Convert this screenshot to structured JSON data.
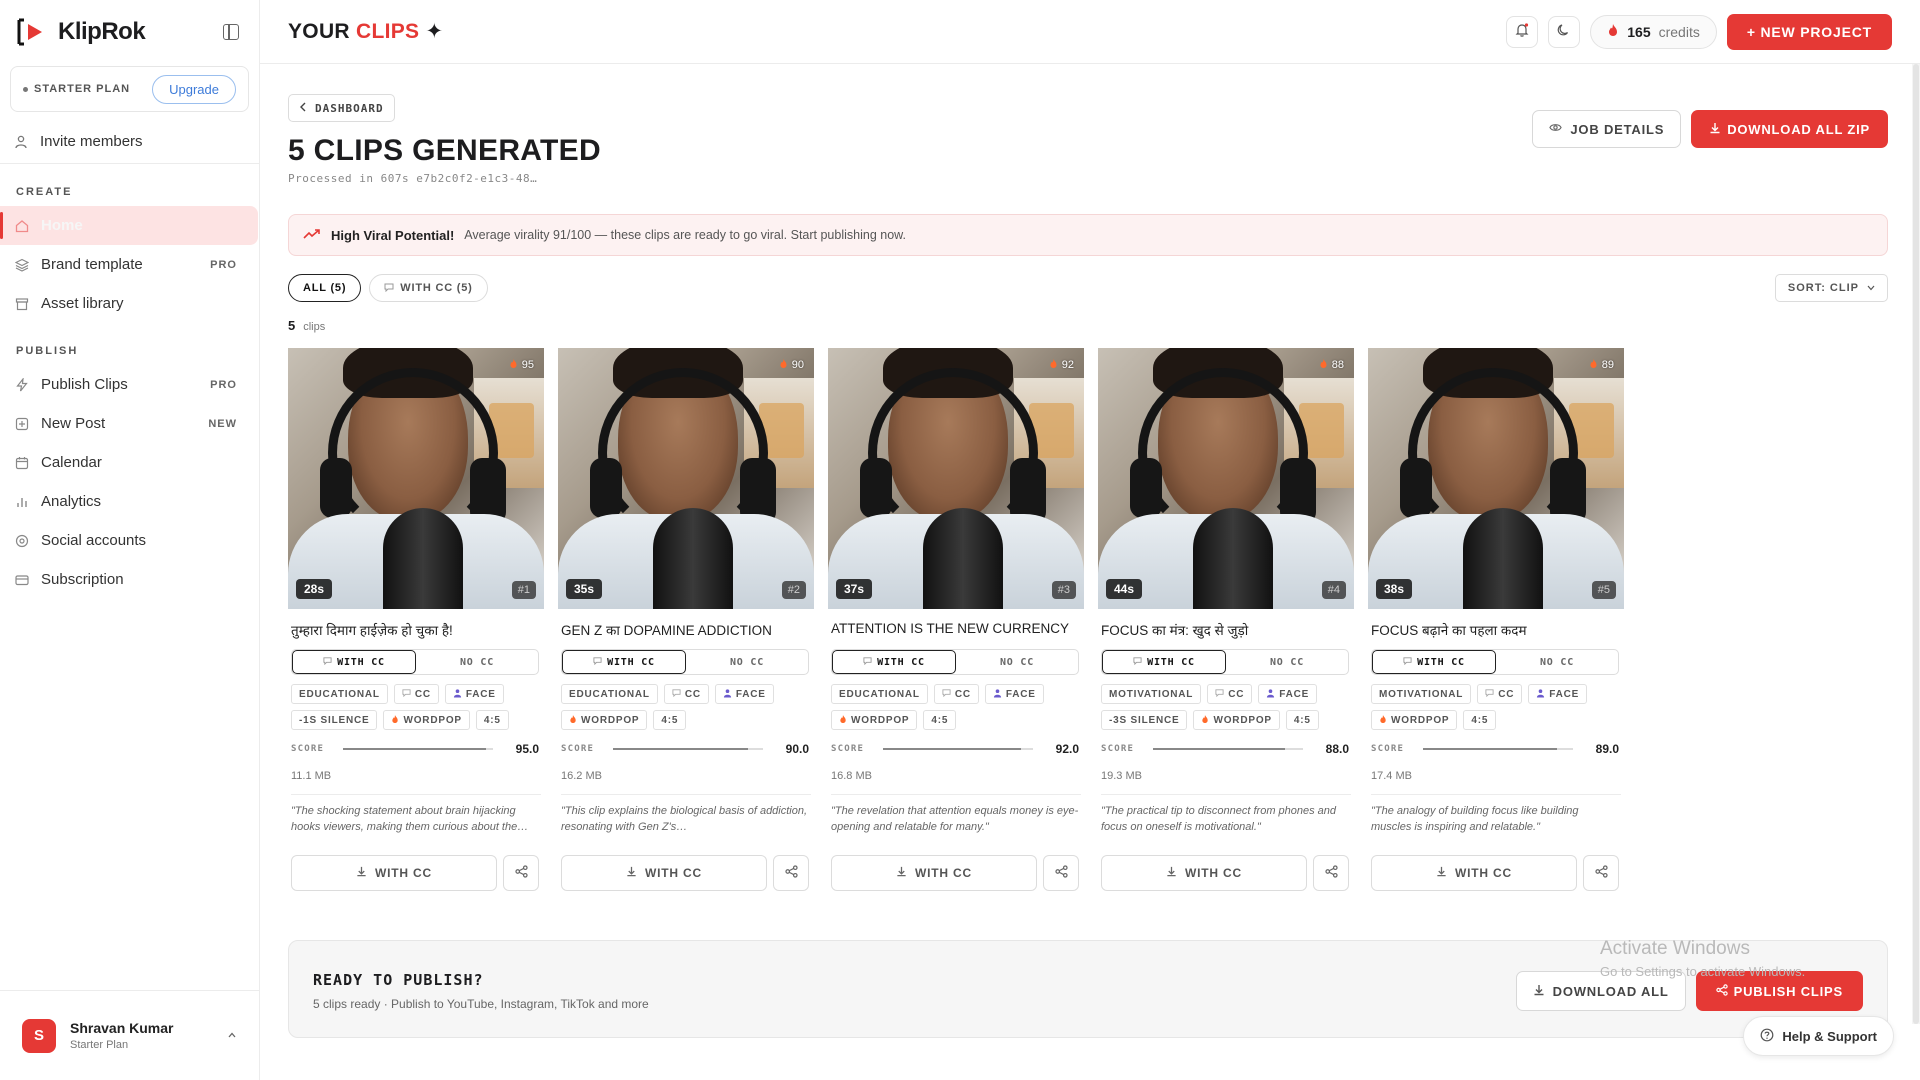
{
  "brand": {
    "name": "KlipRok"
  },
  "sidebar": {
    "plan_label": "STARTER PLAN",
    "upgrade_label": "Upgrade",
    "invite_label": "Invite members",
    "sections": [
      {
        "title": "CREATE",
        "items": [
          {
            "label": "Home",
            "icon": "home-icon",
            "badge": "",
            "active": true
          },
          {
            "label": "Brand template",
            "icon": "layers-icon",
            "badge": "PRO",
            "active": false
          },
          {
            "label": "Asset library",
            "icon": "archive-icon",
            "badge": "",
            "active": false
          }
        ]
      },
      {
        "title": "PUBLISH",
        "items": [
          {
            "label": "Publish Clips",
            "icon": "bolt-icon",
            "badge": "PRO",
            "active": false
          },
          {
            "label": "New Post",
            "icon": "plus-square-icon",
            "badge": "NEW",
            "active": false
          },
          {
            "label": "Calendar",
            "icon": "calendar-icon",
            "badge": "",
            "active": false
          },
          {
            "label": "Analytics",
            "icon": "bar-chart-icon",
            "badge": "",
            "active": false
          },
          {
            "label": "Social accounts",
            "icon": "at-icon",
            "badge": "",
            "active": false
          },
          {
            "label": "Subscription",
            "icon": "card-icon",
            "badge": "",
            "active": false
          }
        ]
      }
    ],
    "user": {
      "initial": "S",
      "name": "Shravan Kumar",
      "plan": "Starter Plan"
    }
  },
  "header": {
    "title_prefix": "YOUR",
    "title_accent": "CLIPS",
    "title_suffix": "✦",
    "credits_value": "165",
    "credits_label": "credits",
    "new_project_label": "+ NEW PROJECT"
  },
  "main": {
    "back_label": "DASHBOARD",
    "title": "5 CLIPS GENERATED",
    "processed": "Processed in 607s  e7b2c0f2-e1c3-48…",
    "job_details_label": "JOB DETAILS",
    "download_zip_label": "DOWNLOAD ALL ZIP",
    "viral_title": "High Viral Potential!",
    "viral_text": "Average virality 91/100 — these clips are ready to go viral. Start publishing now.",
    "filters": [
      {
        "label": "ALL (5)",
        "active": true
      },
      {
        "label": "WITH CC (5)",
        "active": false
      }
    ],
    "sort_label": "SORT: CLIP",
    "count_value": "5",
    "count_label": "clips"
  },
  "clip_labels": {
    "with_cc": "WITH CC",
    "no_cc": "NO CC",
    "score": "SCORE",
    "download_with_cc": "WITH CC"
  },
  "clips": [
    {
      "duration": "28s",
      "index": "#1",
      "virality": "95",
      "title": "तुम्हारा दिमाग हाईज़ेक हो चुका है!",
      "tags": [
        "EDUCATIONAL",
        "CC",
        "FACE",
        "-1S SILENCE",
        "WORDPOP",
        "4:5"
      ],
      "score": "95.0",
      "score_pct": 95,
      "size": "11.1 MB",
      "quote": "\"The shocking statement about brain hijacking hooks viewers, making them curious about the…"
    },
    {
      "duration": "35s",
      "index": "#2",
      "virality": "90",
      "title": "GEN Z का DOPAMINE ADDICTION",
      "tags": [
        "EDUCATIONAL",
        "CC",
        "FACE",
        "WORDPOP",
        "4:5"
      ],
      "score": "90.0",
      "score_pct": 90,
      "size": "16.2 MB",
      "quote": "\"This clip explains the biological basis of addiction, resonating with Gen Z's…"
    },
    {
      "duration": "37s",
      "index": "#3",
      "virality": "92",
      "title": "ATTENTION IS THE NEW CURRENCY",
      "tags": [
        "EDUCATIONAL",
        "CC",
        "FACE",
        "WORDPOP",
        "4:5"
      ],
      "score": "92.0",
      "score_pct": 92,
      "size": "16.8 MB",
      "quote": "\"The revelation that attention equals money is eye-opening and relatable for many.\""
    },
    {
      "duration": "44s",
      "index": "#4",
      "virality": "88",
      "title": "FOCUS का मंत्र: खुद से जुड़ो",
      "tags": [
        "MOTIVATIONAL",
        "CC",
        "FACE",
        "-3S SILENCE",
        "WORDPOP",
        "4:5"
      ],
      "score": "88.0",
      "score_pct": 88,
      "size": "19.3 MB",
      "quote": "\"The practical tip to disconnect from phones and focus on oneself is motivational.\""
    },
    {
      "duration": "38s",
      "index": "#5",
      "virality": "89",
      "title": "FOCUS बढ़ाने का पहला कदम",
      "tags": [
        "MOTIVATIONAL",
        "CC",
        "FACE",
        "WORDPOP",
        "4:5"
      ],
      "score": "89.0",
      "score_pct": 89,
      "size": "17.4 MB",
      "quote": "\"The analogy of building focus like building muscles is inspiring and relatable.\""
    }
  ],
  "publish_card": {
    "title": "READY TO PUBLISH?",
    "subtitle": "5 clips ready · Publish to YouTube, Instagram, TikTok and more",
    "download_all_label": "DOWNLOAD ALL",
    "publish_label": "PUBLISH CLIPS"
  },
  "watermark": {
    "line1": "Activate Windows",
    "line2": "Go to Settings to activate Windows."
  },
  "help_label": "Help & Support",
  "colors": {
    "accent": "#e53935",
    "active_bg": "#fde3e3"
  }
}
